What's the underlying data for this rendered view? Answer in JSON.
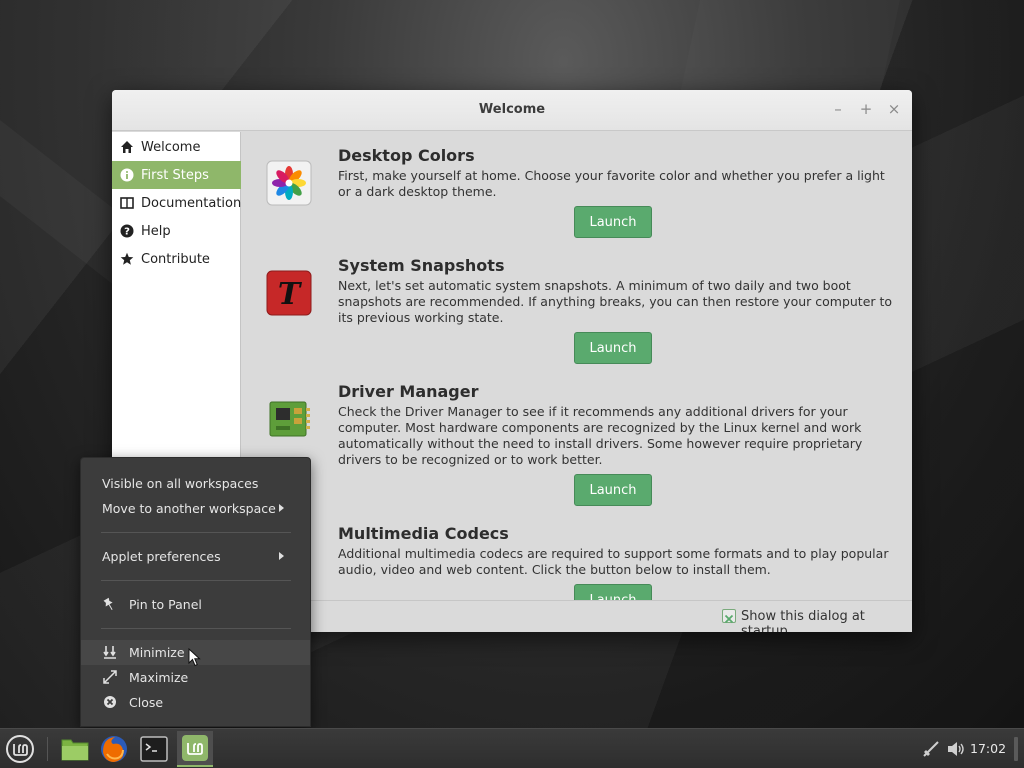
{
  "window": {
    "title": "Welcome",
    "controls": {
      "minimize": "–",
      "maximize": "+",
      "close": "×"
    }
  },
  "sidebar": {
    "items": [
      {
        "label": "Welcome",
        "icon": "home-icon",
        "active": false
      },
      {
        "label": "First Steps",
        "icon": "info-icon",
        "active": true
      },
      {
        "label": "Documentation",
        "icon": "book-icon",
        "active": false
      },
      {
        "label": "Help",
        "icon": "help-icon",
        "active": false
      },
      {
        "label": "Contribute",
        "icon": "star-icon",
        "active": false
      }
    ]
  },
  "entries": [
    {
      "title": "Desktop Colors",
      "description": "First, make yourself at home. Choose your favorite color and whether you prefer a light or a dark desktop theme.",
      "button": "Launch",
      "icon": "desktop-colors-icon"
    },
    {
      "title": "System Snapshots",
      "description": "Next, let's set automatic system snapshots. A minimum of two daily and two boot snapshots are recommended. If anything breaks, you can then restore your computer to its previous working state.",
      "button": "Launch",
      "icon": "timeshift-icon"
    },
    {
      "title": "Driver Manager",
      "description": "Check the Driver Manager to see if it recommends any additional drivers for your computer. Most hardware components are recognized by the Linux kernel and work automatically without the need to install drivers. Some however require proprietary drivers to be recognized or to work better.",
      "button": "Launch",
      "icon": "driver-manager-icon"
    },
    {
      "title": "Multimedia Codecs",
      "description": "Additional multimedia codecs are required to support some formats and to play popular audio, video and web content. Click the button below to install them.",
      "button": "Launch",
      "icon": "multimedia-icon"
    }
  ],
  "footer": {
    "startup_label": "Show this dialog at startup",
    "startup_checked": true
  },
  "context_menu": {
    "items": [
      {
        "label": "Visible on all workspaces"
      },
      {
        "label": "Move to another workspace",
        "submenu": true
      },
      {
        "label": "Applet preferences",
        "submenu": true
      },
      {
        "label": "Pin to Panel",
        "icon": "pin-icon"
      },
      {
        "label": "Minimize",
        "icon": "minimize-icon",
        "hover": true
      },
      {
        "label": "Maximize",
        "icon": "maximize-icon"
      },
      {
        "label": "Close",
        "icon": "close-icon"
      }
    ]
  },
  "panel": {
    "launchers": [
      "mint-menu-icon",
      "files-icon",
      "firefox-icon",
      "terminal-icon",
      "mintwelcome-icon"
    ],
    "clock": "17:02",
    "tray": [
      "network-icon",
      "volume-icon"
    ]
  },
  "colors": {
    "accent": "#8fb76a",
    "launch": "#5aaa6e",
    "menu_bg": "#3c3c3c"
  }
}
